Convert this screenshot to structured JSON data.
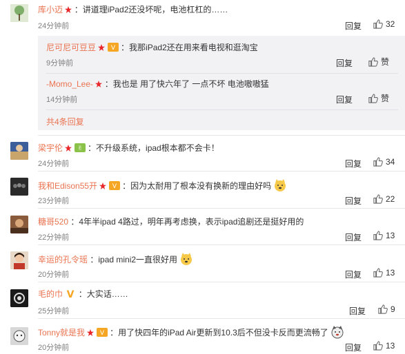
{
  "comments": [
    {
      "user": "库小迈",
      "text": "：讲道理iPad2还没坏呢，电池杠杠的……",
      "time": "24分钟前",
      "reply": "回复",
      "likes": "32",
      "avatar_color": "#9bc28e"
    },
    {
      "user": "梁宇伦",
      "text": "：不升级系统，ipad根本都不会卡！",
      "time": "24分钟前",
      "reply": "回复",
      "likes": "34",
      "avatar_color": "#5b7db8"
    },
    {
      "user": "我和Edison55开",
      "text": "：因为太耐用了根本没有换新的理由好吗",
      "time": "23分钟前",
      "reply": "回复",
      "likes": "22",
      "avatar_color": "#3a3a3a"
    },
    {
      "user": "糖哥520",
      "text": "：4年半ipad 4路过，明年再考虑换，表示ipad追剧还是挺好用的",
      "time": "22分钟前",
      "reply": "回复",
      "likes": "13",
      "avatar_color": "#a07050"
    },
    {
      "user": "幸运的孔令瑶",
      "text": "：ipad mini2一直很好用",
      "time": "20分钟前",
      "reply": "回复",
      "likes": "13",
      "avatar_color": "#c89a7a"
    },
    {
      "user": "毛的巾",
      "text": "：大实话……",
      "time": "25分钟前",
      "reply": "回复",
      "likes": "9",
      "avatar_color": "#222222"
    },
    {
      "user": "Tonny就是我",
      "text": "：用了快四年的iPad Air更新到10.3后不但没卡反而更流畅了",
      "time": "20分钟前",
      "reply": "回复",
      "likes": "13",
      "avatar_color": "#8a8a8a"
    }
  ],
  "sub_replies": [
    {
      "user": "尼可尼可豆豆",
      "text": "：我那iPad2还在用来看电视和逛淘宝",
      "time": "9分钟前",
      "reply": "回复",
      "like_word": "赞"
    },
    {
      "user": "-Momo_Lee-",
      "text": "：我也是 用了快六年了 一点不坏 电池嗷嗷猛",
      "time": "14分钟前",
      "reply": "回复",
      "like_word": "赞"
    }
  ],
  "more_replies": "共4条回复",
  "colors": {
    "accent": "#eb7350",
    "vip_gold": "#f5a623",
    "badge_red": "#e9262a",
    "nested_bg": "#f2f2f5"
  }
}
